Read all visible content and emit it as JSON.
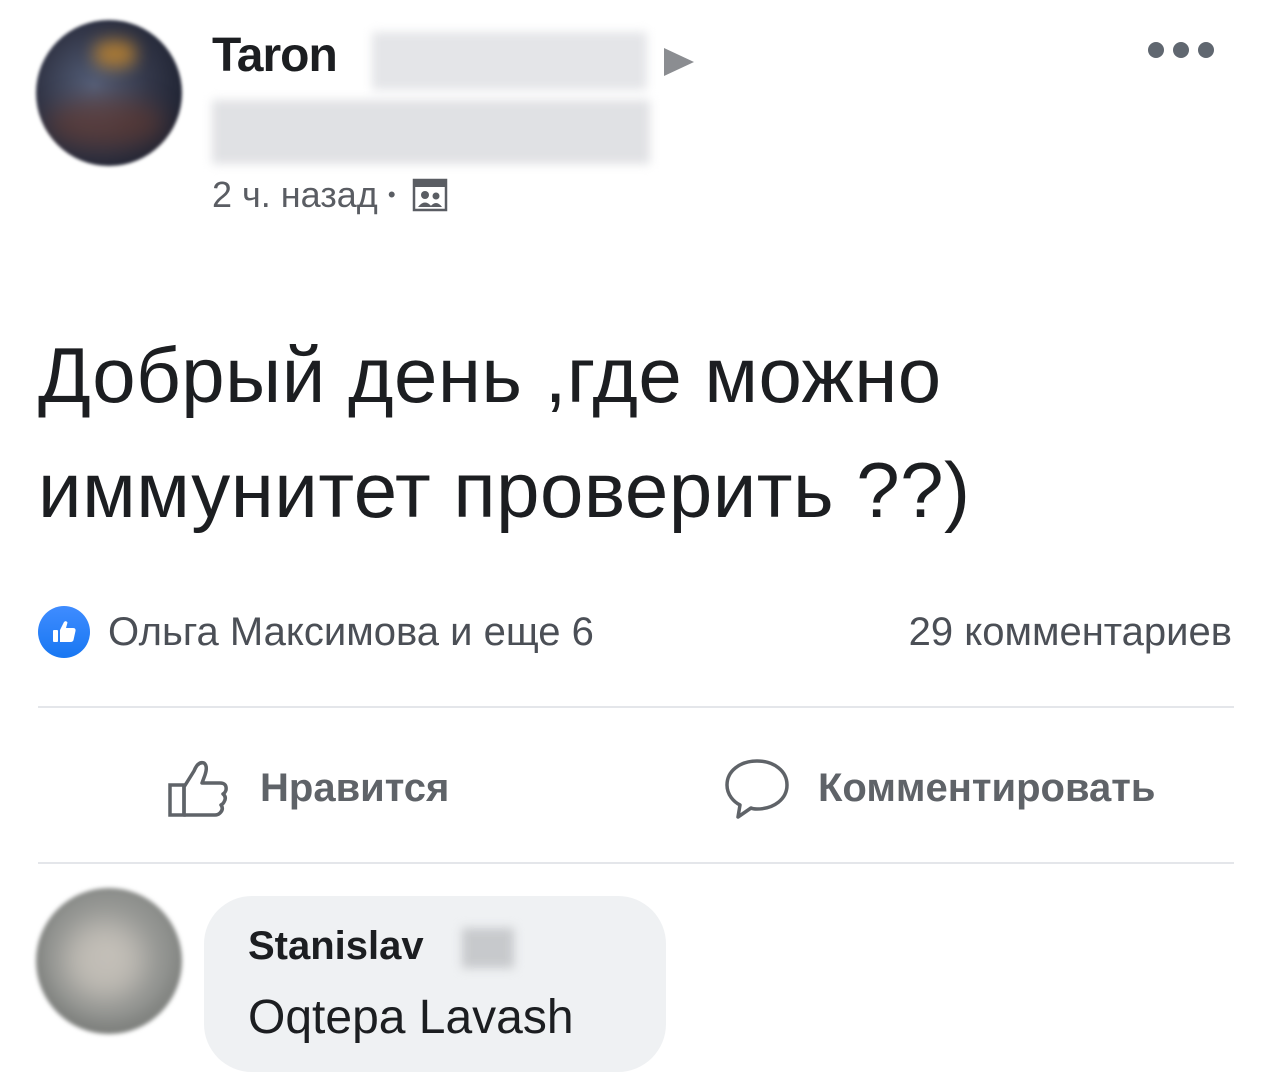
{
  "post": {
    "author_first_name": "Taron",
    "time_ago": "2 ч. назад",
    "separator": "•",
    "text_line_1": "Добрый день ,где можно",
    "text_line_2": "иммунитет проверить ??)"
  },
  "reactions": {
    "summary": "Ольга Максимова и еще 6",
    "comments_count": "29 комментариев"
  },
  "actions": {
    "like_label": "Нравится",
    "comment_label": "Комментировать"
  },
  "comment": {
    "author_first_name": "Stanislav",
    "text": "Oqtepa Lavash"
  },
  "icons": {
    "more": "more-dots-icon",
    "share_arrow": "arrow-right-icon",
    "audience": "group-audience-icon",
    "like_reaction": "thumbs-up-icon",
    "like_action": "thumbs-up-outline-icon",
    "comment_action": "speech-bubble-icon"
  },
  "colors": {
    "facebook_blue": "#1877f2",
    "text_primary": "#1c1e21",
    "text_secondary": "#5f6368",
    "comment_bg": "#eff1f3"
  }
}
